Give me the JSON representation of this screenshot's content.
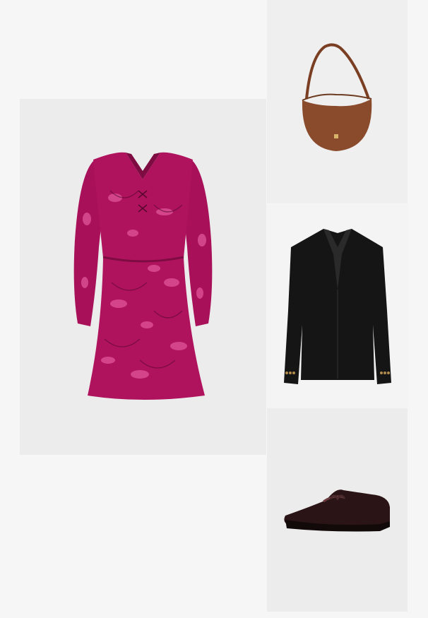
{
  "outfit": {
    "items": [
      {
        "id": "dress",
        "alt": ""
      },
      {
        "id": "bag",
        "alt": ""
      },
      {
        "id": "blazer",
        "alt": ""
      },
      {
        "id": "shoes",
        "alt": ""
      }
    ]
  },
  "colors": {
    "page_background": "#f6f6f6",
    "tile_background": "#ececec",
    "dress_base": "#b0135e",
    "dress_pattern": "#e0559a",
    "bag": "#8a4a2c",
    "blazer": "#151515",
    "shoes": "#2a1416"
  }
}
